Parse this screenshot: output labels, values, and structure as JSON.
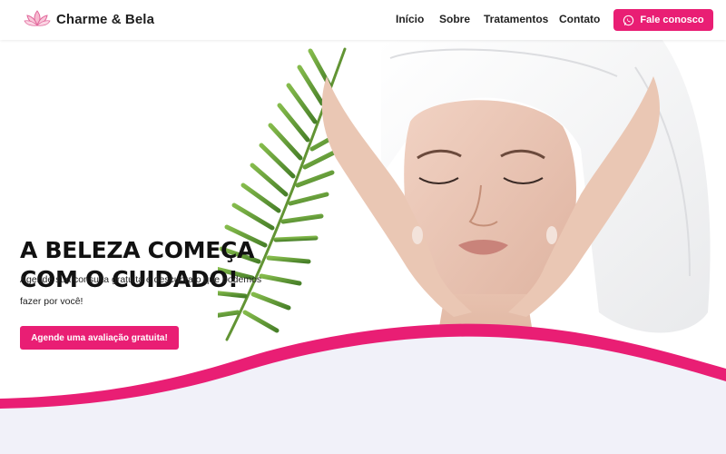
{
  "brand": {
    "name": "Charme & Bela",
    "icon": "lotus-icon",
    "accent_color": "#e91e74"
  },
  "nav": {
    "items": [
      {
        "label": "Início"
      },
      {
        "label": "Sobre"
      },
      {
        "label": "Tratamentos"
      },
      {
        "label": "Contato"
      }
    ],
    "cta_label": "Fale conosco",
    "cta_icon": "whatsapp-icon"
  },
  "hero": {
    "headline_line1": "A BELEZA COMEÇA",
    "headline_line2": "COM O CUIDADO!",
    "subtext": "Agende sua consulta gratuita e descubra o que podemos fazer por você!",
    "cta_label": "Agende uma avaliação gratuita!",
    "image": "woman-facial-massage-towel-palm-leaf"
  }
}
